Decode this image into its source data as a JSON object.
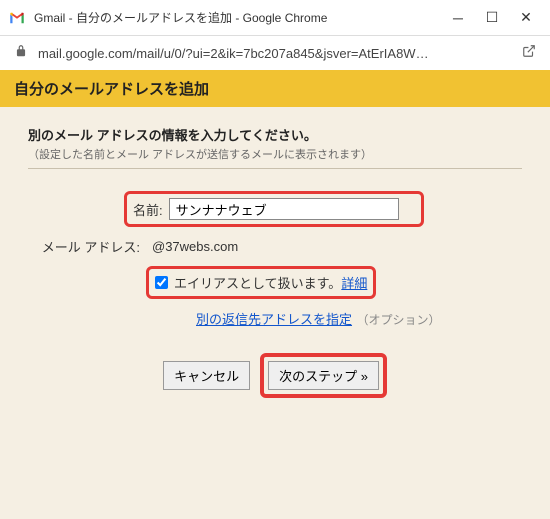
{
  "titlebar": {
    "title": "Gmail - 自分のメールアドレスを追加 - Google Chrome"
  },
  "addressbar": {
    "url": "mail.google.com/mail/u/0/?ui=2&ik=7bc207a845&jsver=AtErIA8W…"
  },
  "page": {
    "header": "自分のメールアドレスを追加",
    "instruction": "別のメール アドレスの情報を入力してください。",
    "subnote": "（設定した名前とメール アドレスが送信するメールに表示されます）",
    "form": {
      "name_label": "名前:",
      "name_value": "サンナナウェブ",
      "email_label": "メール アドレス:",
      "email_value": "@37webs.com",
      "alias_label": "エイリアスとして扱います。",
      "alias_link": "詳細",
      "reply_link": "別の返信先アドレスを指定",
      "reply_note": "（オプション）"
    },
    "buttons": {
      "cancel": "キャンセル",
      "next": "次のステップ »"
    }
  }
}
